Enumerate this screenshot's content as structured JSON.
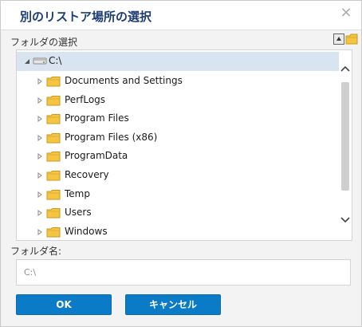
{
  "dialog": {
    "title": "別のリストア場所の選択",
    "close_glyph": "×"
  },
  "folder_select": {
    "label": "フォルダの選択"
  },
  "tree": {
    "root": {
      "label": "C:\\",
      "selected": true,
      "icon": "drive-icon"
    },
    "children": [
      {
        "label": "Documents and Settings",
        "icon": "folder-icon"
      },
      {
        "label": "PerfLogs",
        "icon": "folder-icon"
      },
      {
        "label": "Program Files",
        "icon": "folder-icon"
      },
      {
        "label": "Program Files (x86)",
        "icon": "folder-icon"
      },
      {
        "label": "ProgramData",
        "icon": "folder-icon"
      },
      {
        "label": "Recovery",
        "icon": "folder-icon"
      },
      {
        "label": "Temp",
        "icon": "folder-icon"
      },
      {
        "label": "Users",
        "icon": "folder-icon"
      },
      {
        "label": "Windows",
        "icon": "folder-icon"
      }
    ]
  },
  "folder_name": {
    "label": "フォルダ名:",
    "value": "C:\\"
  },
  "buttons": {
    "ok": "OK",
    "cancel": "キャンセル"
  },
  "colors": {
    "title": "#1c3d73",
    "selection": "#d9e4f1",
    "button": "#0b7ac7",
    "folder": "#f5c542"
  }
}
